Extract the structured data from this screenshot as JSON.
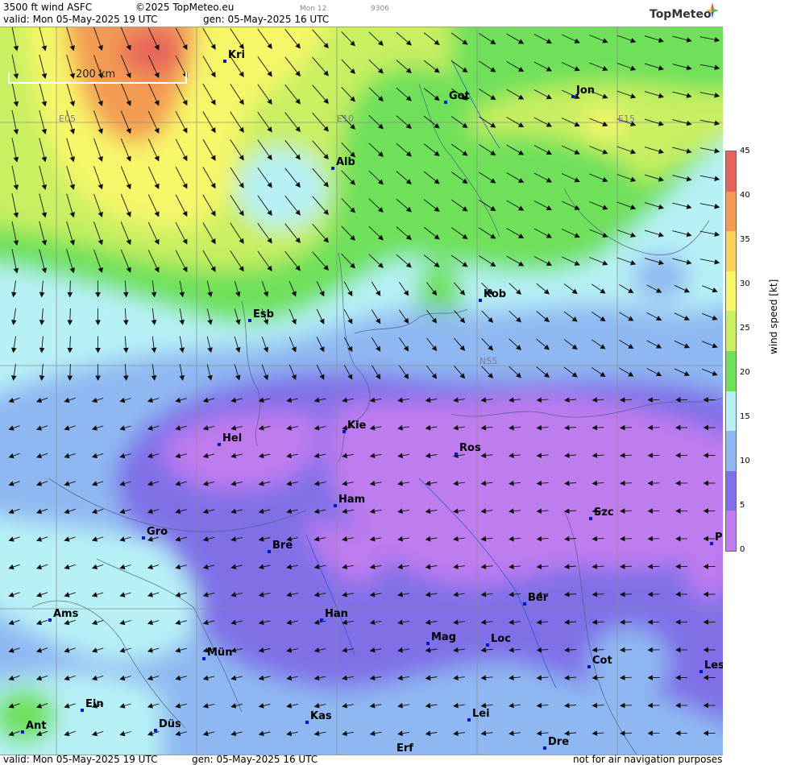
{
  "header": {
    "product": "3500 ft wind ASFC",
    "copyright": "©2025 TopMeteo.eu",
    "day_code": "Mon 12",
    "run_code": "9306",
    "valid": "valid:  Mon  05-May-2025  19 UTC",
    "gen": "gen: 05-May-2025 16 UTC"
  },
  "logo": {
    "name": "TopMeteo",
    "icon": "compass-star-icon"
  },
  "scale": {
    "label": "200 km"
  },
  "grid_labels": {
    "e05": "E05",
    "e10": "E10",
    "e15": "E15",
    "n55": "N55"
  },
  "cities": [
    {
      "id": "kri",
      "name": "Kri"
    },
    {
      "id": "got",
      "name": "Got"
    },
    {
      "id": "jon",
      "name": "Jon"
    },
    {
      "id": "alb",
      "name": "Alb"
    },
    {
      "id": "kob",
      "name": "Kob"
    },
    {
      "id": "esb",
      "name": "Esb"
    },
    {
      "id": "kie",
      "name": "Kie"
    },
    {
      "id": "hel",
      "name": "Hel"
    },
    {
      "id": "ros",
      "name": "Ros"
    },
    {
      "id": "ham",
      "name": "Ham"
    },
    {
      "id": "szc",
      "name": "Szc"
    },
    {
      "id": "gro",
      "name": "Gro"
    },
    {
      "id": "bre",
      "name": "Bre"
    },
    {
      "id": "p",
      "name": "P"
    },
    {
      "id": "ber",
      "name": "Ber"
    },
    {
      "id": "ams",
      "name": "Ams"
    },
    {
      "id": "han",
      "name": "Han"
    },
    {
      "id": "mag",
      "name": "Mag"
    },
    {
      "id": "loc",
      "name": "Loc"
    },
    {
      "id": "mun",
      "name": "Mün"
    },
    {
      "id": "cot",
      "name": "Cot"
    },
    {
      "id": "les",
      "name": "Les"
    },
    {
      "id": "ein",
      "name": "Ein"
    },
    {
      "id": "kas",
      "name": "Kas"
    },
    {
      "id": "lei",
      "name": "Lei"
    },
    {
      "id": "ant",
      "name": "Ant"
    },
    {
      "id": "dus",
      "name": "Düs"
    },
    {
      "id": "dre",
      "name": "Dre"
    },
    {
      "id": "erf",
      "name": "Erf"
    }
  ],
  "legend": {
    "title": "wind speed [kt]",
    "ticks": [
      "45",
      "40",
      "35",
      "30",
      "25",
      "20",
      "15",
      "10",
      "5",
      "0"
    ],
    "colors": [
      "#e8635a",
      "#f39b52",
      "#fbd35a",
      "#f7f76a",
      "#c9ef62",
      "#6ee05a",
      "#b7f1f6",
      "#8fb8f2",
      "#7f6fe8",
      "#bf7bef"
    ]
  },
  "footer": {
    "valid": "valid:  Mon  05-May-2025  19 UTC",
    "gen": "gen:  05-May-2025 16 UTC",
    "disclaimer": "not for air navigation purposes"
  }
}
